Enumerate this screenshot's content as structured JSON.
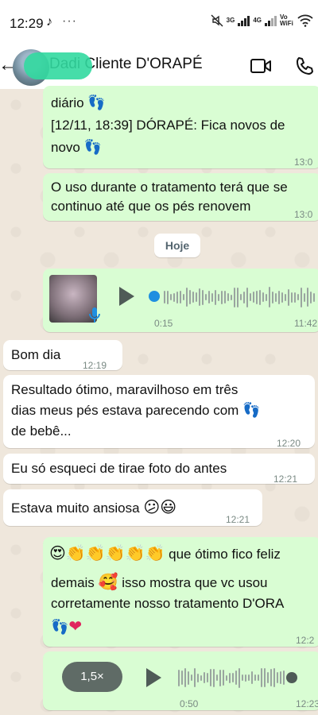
{
  "status_bar": {
    "time": "12:29",
    "network_3g": "3G",
    "network_4g": "4G",
    "vowifi": "Vo WiFi"
  },
  "header": {
    "contact_name": "Dadi Cliente D'ORAPÉ"
  },
  "messages": {
    "m1": {
      "line1": "diário",
      "line2": "[12/11, 18:39] DÓRAPÉ: Fica novos de",
      "line3": "novo",
      "time": "13:0"
    },
    "m2": {
      "line1": "O uso durante o tratamento terá que se",
      "line2": "continuo até que os pés renovem",
      "time": "13:0"
    },
    "date_divider": "Hoje",
    "voice1": {
      "duration": "0:15",
      "time": "11:42"
    },
    "m3": {
      "text": "Bom dia",
      "time": "12:19"
    },
    "m4": {
      "line1": "Resultado ótimo, maravilhoso em três",
      "line2": "dias meus pés estava parecendo com",
      "line3": "de bebê...",
      "time": "12:20"
    },
    "m5": {
      "text": "Eu só esqueci de tirae foto do antes",
      "time": "12:21"
    },
    "m6": {
      "text": "Estava muito ansiosa",
      "time": "12:21"
    },
    "m7": {
      "line1": "que ótimo fico feliz",
      "line2": "demais",
      "line2b": "isso mostra que vc usou",
      "line3": "corretamente nosso tratamento D'ORA",
      "time": "12:2"
    },
    "voice2": {
      "speed": "1,5×",
      "duration": "0:50",
      "time": "12:23"
    }
  }
}
